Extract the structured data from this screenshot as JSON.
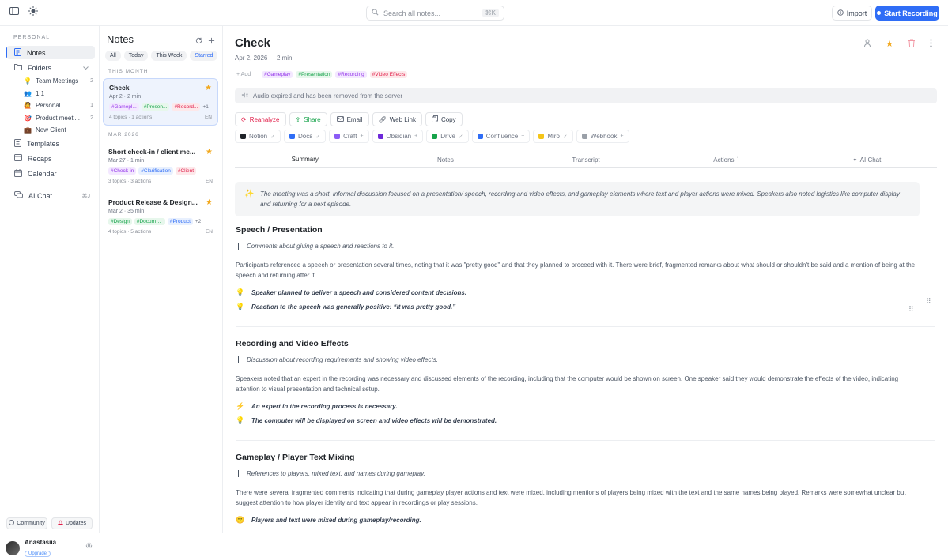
{
  "topbar": {
    "search_placeholder": "Search all notes...",
    "search_shortcut": "⌘K",
    "import_label": "Import",
    "record_label": "Start Recording"
  },
  "sidebar": {
    "section_label": "PERSONAL",
    "items": [
      {
        "label": "Notes",
        "icon": "notes-icon"
      },
      {
        "label": "Folders",
        "icon": "folder-icon"
      },
      {
        "label": "Templates",
        "icon": "template-icon"
      },
      {
        "label": "Recaps",
        "icon": "recaps-icon"
      },
      {
        "label": "Calendar",
        "icon": "calendar-icon"
      },
      {
        "label": "AI Chat",
        "icon": "chat-icon",
        "shortcut": "⌘J"
      }
    ],
    "folders": [
      {
        "emoji": "💡",
        "label": "Team Meetings",
        "count": "2"
      },
      {
        "emoji": "👥",
        "label": "1:1",
        "count": ""
      },
      {
        "emoji": "🙋",
        "label": "Personal",
        "count": "1"
      },
      {
        "emoji": "🎯",
        "label": "Product meeti...",
        "count": "2"
      },
      {
        "emoji": "💼",
        "label": "New Client",
        "count": ""
      }
    ],
    "community_label": "Community",
    "updates_label": "Updates",
    "user_name": "Anastasiia",
    "upgrade_label": "Upgrade"
  },
  "notes_list": {
    "title": "Notes",
    "filters": [
      "All",
      "Today",
      "This Week",
      "Starred"
    ],
    "group_this_month": "THIS MONTH",
    "group_mar": "MAR 2026",
    "cards": [
      {
        "title": "Check",
        "date": "Apr 2",
        "duration": "2 min",
        "tags": [
          "#Gamepl...",
          "#Presen...",
          "#Record..."
        ],
        "more": "+1",
        "topics": "4 topics",
        "actions": "1 actions",
        "lang": "EN"
      },
      {
        "title": "Short check-in / client me...",
        "date": "Mar 27",
        "duration": "1 min",
        "tags": [
          "#Check-in",
          "#Clarification",
          "#Client"
        ],
        "more": "",
        "topics": "3 topics",
        "actions": "3 actions",
        "lang": "EN"
      },
      {
        "title": "Product Release & Design...",
        "date": "Mar 2",
        "duration": "35 min",
        "tags": [
          "#Design",
          "#Docume...",
          "#Product"
        ],
        "more": "+2",
        "topics": "4 topics",
        "actions": "5 actions",
        "lang": "EN"
      }
    ]
  },
  "note": {
    "title": "Check",
    "date": "Apr 2, 2026",
    "duration": "2 min",
    "add_tag": "+ Add",
    "tags": [
      "#Gameplay",
      "#Presentation",
      "#Recording",
      "#Video Effects"
    ],
    "audio_notice": "Audio expired and has been removed from the server",
    "actions": [
      "Reanalyze",
      "Share",
      "Email",
      "Web Link",
      "Copy"
    ],
    "integrations": [
      {
        "label": "Notion",
        "trail": "✓",
        "color": "#1f2328"
      },
      {
        "label": "Docs",
        "trail": "✓",
        "color": "#2f6df6"
      },
      {
        "label": "Craft",
        "trail": "+",
        "color": "#8b5cf6"
      },
      {
        "label": "Obsidian",
        "trail": "+",
        "color": "#6d28d9"
      },
      {
        "label": "Drive",
        "trail": "✓",
        "color": "#16a34a"
      },
      {
        "label": "Confluence",
        "trail": "+",
        "color": "#2f6df6"
      },
      {
        "label": "Miro",
        "trail": "✓",
        "color": "#f5c518"
      },
      {
        "label": "Webhook",
        "trail": "+",
        "color": "#9aa0a8"
      }
    ],
    "tabs": [
      {
        "label": "Summary",
        "badge": ""
      },
      {
        "label": "Notes",
        "badge": ""
      },
      {
        "label": "Transcript",
        "badge": ""
      },
      {
        "label": "Actions",
        "badge": "1"
      },
      {
        "label": "AI Chat",
        "badge": ""
      }
    ],
    "summary": "The meeting was a short, informal discussion focused on a presentation/ speech, recording and video effects, and gameplay elements where text and player actions were mixed. Speakers also noted logistics like computer display and returning for a next episode.",
    "sections": [
      {
        "heading": "Speech / Presentation",
        "quote": "Comments about giving a speech and reactions to it.",
        "paragraph": "Participants referenced a speech or presentation several times, noting that it was \"pretty good\" and that they planned to proceed with it. There were brief, fragmented remarks about what should or shouldn't be said and a mention of being at the speech and returning after it.",
        "bullets": [
          {
            "icon": "💡",
            "text": "Speaker planned to deliver a speech and considered content decisions."
          },
          {
            "icon": "💡",
            "text": "Reaction to the speech was generally positive: “it was pretty good.”"
          }
        ]
      },
      {
        "heading": "Recording and Video Effects",
        "quote": "Discussion about recording requirements and showing video effects.",
        "paragraph": "Speakers noted that an expert in the recording was necessary and discussed elements of the recording, including that the computer would be shown on screen. One speaker said they would demonstrate the effects of the video, indicating attention to visual presentation and technical setup.",
        "bullets": [
          {
            "icon": "⚡",
            "text": "An expert in the recording process is necessary."
          },
          {
            "icon": "💡",
            "text": "The computer will be displayed on screen and video effects will be demonstrated."
          }
        ]
      },
      {
        "heading": "Gameplay / Player Text Mixing",
        "quote": "References to players, mixed text, and names during gameplay.",
        "paragraph": "There were several fragmented comments indicating that during gameplay player actions and text were mixed, including mentions of players being mixed with the text and the same names being played. Remarks were somewhat unclear but suggest attention to how player identity and text appear in recordings or play sessions.",
        "bullets": [
          {
            "icon": "😕",
            "text": "Players and text were mixed during gameplay/recording."
          }
        ]
      }
    ]
  }
}
